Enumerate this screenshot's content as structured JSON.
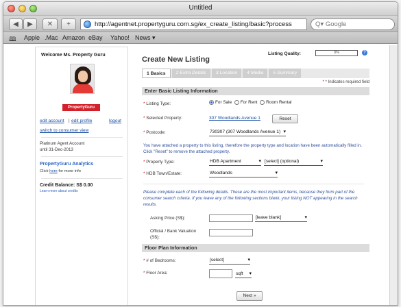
{
  "window": {
    "title": "Untitled"
  },
  "toolbar": {
    "back": "◀",
    "forward": "▶",
    "stop": "✕",
    "add": "+",
    "url": "http://agentnet.propertyguru.com.sg/ex_create_listing/basic?process",
    "search_placeholder": "Google"
  },
  "bookmarks": [
    "Apple",
    ".Mac",
    "Amazon",
    "eBay",
    "Yahoo!",
    "News ▾"
  ],
  "sidebar": {
    "welcome": "Welcome Ms. Property Guru",
    "logo_text": "PropertyGuru",
    "edit_account": "edit account",
    "edit_profile": "edit profile",
    "logout": "logout",
    "switch_view": "switch to consumer view",
    "account_type": "Platinum Agent Account",
    "account_until": "until 31-Dec-2013",
    "analytics_title": "PropertyGuru Analytics",
    "analytics_pre": "Click ",
    "analytics_link": "here",
    "analytics_post": " for more info",
    "credit_balance": "Credit Balance: S$ 0.00",
    "credit_link": "Learn more about credits"
  },
  "main": {
    "title": "Create New Listing",
    "quality_label": "Listing Quality:",
    "quality_value": "0%",
    "quality_help": "?",
    "steps": [
      "1 Basics",
      "2 Extra Details",
      "3 Location",
      "4 Media",
      "5 Summary"
    ],
    "required_note": "* Indicates required field",
    "section_basic": "Enter Basic Listing Information",
    "listing_type_label": "Listing Type:",
    "listing_types": [
      "For Sale",
      "For Rent",
      "Room Rental"
    ],
    "selected_property_label": "Selected Property:",
    "selected_property_value": "307 Woodlands Avenue 1",
    "reset_label": "Reset",
    "postcode_label": "Postcode:",
    "postcode_value": "730307 (307 Woodlands Avenue 1)",
    "attached_note": "You have attached a property to this listing, therefore the property type and location have been automatically filled in. Click \"Reset\" to remove the attached property.",
    "property_type_label": "Property Type:",
    "property_type_value": "HDB Apartment",
    "property_subtype_value": "[select] (optional)",
    "hdb_town_label": "HDB Town/Estate:",
    "hdb_town_value": "Woodlands",
    "complete_note": "Please complete each of the following details. These are the most important items, because they form part of the consumer search criteria. If you leave any of the following sections blank, your listing NOT appearing in the search results.",
    "asking_price_label": "Asking Price (S$):",
    "asking_price_value": "",
    "asking_price_option": "[leave blank]",
    "valuation_label": "Official / Bank Valuation (S$):",
    "valuation_value": "",
    "section_floor": "Floor Plan Information",
    "bedrooms_label": "# of Bedrooms:",
    "bedrooms_value": "[select]",
    "floor_area_label": "Floor Area:",
    "floor_area_value": "",
    "floor_area_unit": "sqft",
    "next_label": "Next »"
  }
}
